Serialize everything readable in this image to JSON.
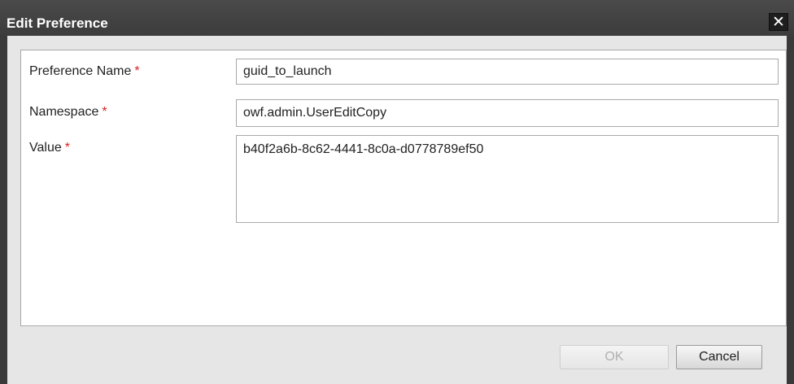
{
  "dialog": {
    "title": "Edit Preference",
    "close_symbol": "✕"
  },
  "form": {
    "required_marker": "*",
    "fields": [
      {
        "label": "Preference Name",
        "value": "guid_to_launch"
      },
      {
        "label": "Namespace",
        "value": "owf.admin.UserEditCopy"
      },
      {
        "label": "Value",
        "value": "b40f2a6b-8c62-4441-8c0a-d0778789ef50"
      }
    ]
  },
  "buttons": {
    "ok_label": "OK",
    "ok_enabled": false,
    "cancel_label": "Cancel"
  },
  "icons": {
    "close": "close-icon"
  },
  "colors": {
    "titlebar": "#3c3c3c",
    "required_marker": "#e02020",
    "dialog_background": "#e6e6e6"
  }
}
